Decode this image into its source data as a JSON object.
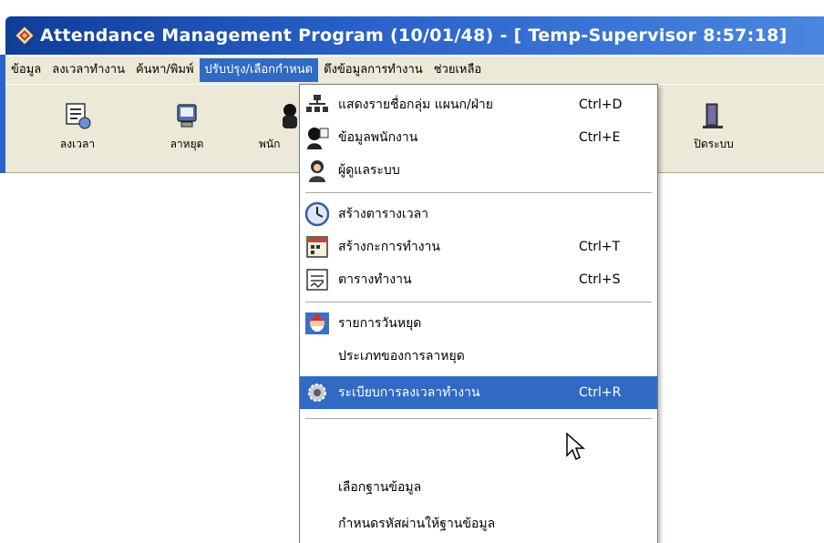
{
  "window": {
    "title": "Attendance Management Program (10/01/48) - [ Temp-Supervisor 8:57:18]",
    "icon": "app-diamond-icon"
  },
  "menubar": {
    "items": [
      {
        "label": "ข้อมูล"
      },
      {
        "label": "ลงเวลาทำงาน"
      },
      {
        "label": "ค้นหา/พิมพ์"
      },
      {
        "label": "ปรับปรุง/เลือกกำหนด",
        "active": true
      },
      {
        "label": "ดึงข้อมูลการทำงาน"
      },
      {
        "label": "ช่วยเหลือ"
      }
    ]
  },
  "toolbar": {
    "buttons": [
      {
        "label": "ลงเวลา",
        "icon": "clock-in-icon"
      },
      {
        "label": "ลาหยุด",
        "icon": "leave-icon"
      },
      {
        "label": "พนัก",
        "icon": "employee-icon"
      },
      {
        "label": "ปิดระบบ",
        "icon": "exit-door-icon"
      }
    ]
  },
  "dropdown": {
    "items": [
      {
        "label": "แสดงรายชื่อกลุ่ม แผนก/ฝ่าย",
        "shortcut": "Ctrl+D",
        "icon": "org-chart-icon"
      },
      {
        "label": "ข้อมูลพนักงาน",
        "shortcut": "Ctrl+E",
        "icon": "employee-info-icon"
      },
      {
        "label": "ผู้ดูแลระบบ",
        "shortcut": "",
        "icon": "admin-user-icon"
      },
      {
        "label": "สร้างตารางเวลา",
        "shortcut": "",
        "icon": "clock-icon"
      },
      {
        "label": "สร้างกะการทำงาน",
        "shortcut": "Ctrl+T",
        "icon": "shift-calendar-icon"
      },
      {
        "label": "ตารางทำงาน",
        "shortcut": "Ctrl+S",
        "icon": "schedule-icon"
      },
      {
        "label": "รายการวันหยุด",
        "shortcut": "",
        "icon": "holiday-santa-icon"
      },
      {
        "label": "ประเภทของการลาหยุด",
        "shortcut": "",
        "icon": ""
      },
      {
        "label": "ระเบียบการลงเวลาทำงาน",
        "shortcut": "Ctrl+R",
        "icon": "rules-gear-icon",
        "active": true
      },
      {
        "label": "เลือกฐานข้อมูล",
        "shortcut": "",
        "icon": ""
      },
      {
        "label": "กำหนดรหัสผ่านให้ฐานข้อมูล",
        "shortcut": "",
        "icon": ""
      }
    ]
  },
  "colors": {
    "titlebar": "#2a63c9",
    "menu_highlight": "#316ac5",
    "chrome": "#ece9d8"
  }
}
